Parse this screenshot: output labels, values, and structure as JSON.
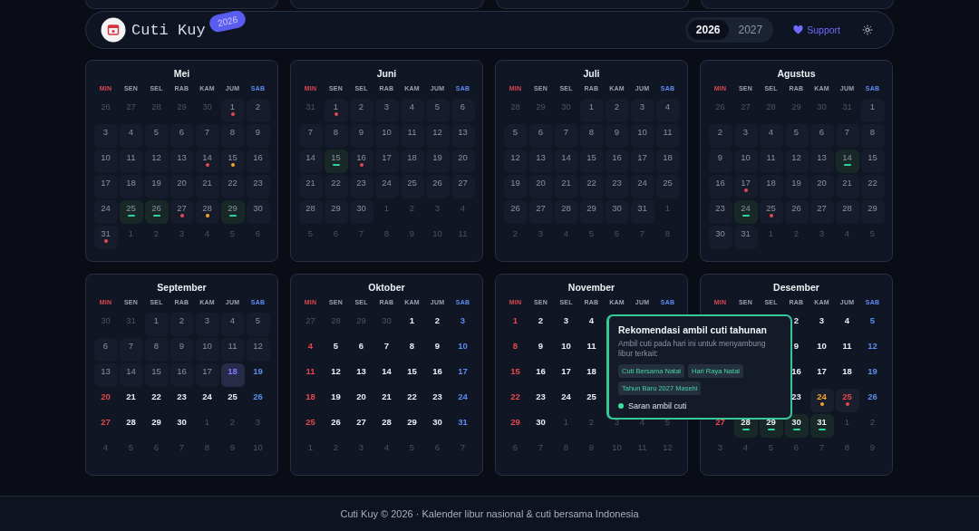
{
  "header": {
    "title": "Cuti Kuy",
    "badge": "2026",
    "years": [
      {
        "label": "2026",
        "selected": true
      },
      {
        "label": "2027",
        "selected": false
      }
    ],
    "support": "Support"
  },
  "months": [
    {
      "name": "Mei",
      "weekdays": [
        "MIN",
        "SEN",
        "SEL",
        "RAB",
        "KAM",
        "JUM",
        "SAB"
      ],
      "weeks": [
        {
          "days": [
            {
              "day": "26",
              "kind": "out"
            },
            {
              "day": "27",
              "kind": "out"
            },
            {
              "day": "28",
              "kind": "out"
            },
            {
              "day": "29",
              "kind": "out"
            },
            {
              "day": "30",
              "kind": "out"
            },
            {
              "day": "1",
              "kind": "past",
              "color": "#e5484d",
              "suggested": false
            },
            {
              "day": "2",
              "kind": "past"
            }
          ]
        },
        {
          "days": [
            {
              "day": "3",
              "kind": "past"
            },
            {
              "day": "4",
              "kind": "past"
            },
            {
              "day": "5",
              "kind": "past"
            },
            {
              "day": "6",
              "kind": "past"
            },
            {
              "day": "7",
              "kind": "past"
            },
            {
              "day": "8",
              "kind": "past"
            },
            {
              "day": "9",
              "kind": "past"
            }
          ]
        },
        {
          "days": [
            {
              "day": "10",
              "kind": "past"
            },
            {
              "day": "11",
              "kind": "past"
            },
            {
              "day": "12",
              "kind": "past"
            },
            {
              "day": "13",
              "kind": "past"
            },
            {
              "day": "14",
              "kind": "past",
              "color": "#e5484d",
              "suggested": false
            },
            {
              "day": "15",
              "kind": "past",
              "color": "#f5a524",
              "suggested": false
            },
            {
              "day": "16",
              "kind": "past"
            }
          ]
        },
        {
          "days": [
            {
              "day": "17",
              "kind": "past"
            },
            {
              "day": "18",
              "kind": "past"
            },
            {
              "day": "19",
              "kind": "past"
            },
            {
              "day": "20",
              "kind": "past"
            },
            {
              "day": "21",
              "kind": "past"
            },
            {
              "day": "22",
              "kind": "past"
            },
            {
              "day": "23",
              "kind": "past"
            }
          ]
        },
        {
          "days": [
            {
              "day": "24",
              "kind": "past"
            },
            {
              "day": "25",
              "kind": "past",
              "color": "#2fd3a0",
              "suggested": true
            },
            {
              "day": "26",
              "kind": "past",
              "color": "#2fd3a0",
              "suggested": true
            },
            {
              "day": "27",
              "kind": "past",
              "color": "#e5484d",
              "suggested": false
            },
            {
              "day": "28",
              "kind": "past",
              "color": "#f5a524",
              "suggested": false
            },
            {
              "day": "29",
              "kind": "past",
              "color": "#2fd3a0",
              "suggested": true
            },
            {
              "day": "30",
              "kind": "past"
            }
          ]
        },
        {
          "days": [
            {
              "day": "31",
              "kind": "past",
              "color": "#e5484d",
              "suggested": false
            },
            {
              "day": "1",
              "kind": "out"
            },
            {
              "day": "2",
              "kind": "out"
            },
            {
              "day": "3",
              "kind": "out"
            },
            {
              "day": "4",
              "kind": "out"
            },
            {
              "day": "5",
              "kind": "out"
            },
            {
              "day": "6",
              "kind": "out"
            }
          ]
        }
      ]
    },
    {
      "name": "Juni",
      "weekdays": [
        "MIN",
        "SEN",
        "SEL",
        "RAB",
        "KAM",
        "JUM",
        "SAB"
      ],
      "weeks": [
        {
          "days": [
            {
              "day": "31",
              "kind": "out"
            },
            {
              "day": "1",
              "kind": "past",
              "color": "#e5484d",
              "suggested": false
            },
            {
              "day": "2",
              "kind": "past"
            },
            {
              "day": "3",
              "kind": "past"
            },
            {
              "day": "4",
              "kind": "past"
            },
            {
              "day": "5",
              "kind": "past"
            },
            {
              "day": "6",
              "kind": "past"
            }
          ]
        },
        {
          "days": [
            {
              "day": "7",
              "kind": "past"
            },
            {
              "day": "8",
              "kind": "past"
            },
            {
              "day": "9",
              "kind": "past"
            },
            {
              "day": "10",
              "kind": "past"
            },
            {
              "day": "11",
              "kind": "past"
            },
            {
              "day": "12",
              "kind": "past"
            },
            {
              "day": "13",
              "kind": "past"
            }
          ]
        },
        {
          "days": [
            {
              "day": "14",
              "kind": "past"
            },
            {
              "day": "15",
              "kind": "past",
              "color": "#2fd3a0",
              "suggested": true
            },
            {
              "day": "16",
              "kind": "past",
              "color": "#e5484d",
              "suggested": false
            },
            {
              "day": "17",
              "kind": "past"
            },
            {
              "day": "18",
              "kind": "past"
            },
            {
              "day": "19",
              "kind": "past"
            },
            {
              "day": "20",
              "kind": "past"
            }
          ]
        },
        {
          "days": [
            {
              "day": "21",
              "kind": "past"
            },
            {
              "day": "22",
              "kind": "past"
            },
            {
              "day": "23",
              "kind": "past"
            },
            {
              "day": "24",
              "kind": "past"
            },
            {
              "day": "25",
              "kind": "past"
            },
            {
              "day": "26",
              "kind": "past"
            },
            {
              "day": "27",
              "kind": "past"
            }
          ]
        },
        {
          "days": [
            {
              "day": "28",
              "kind": "past"
            },
            {
              "day": "29",
              "kind": "past"
            },
            {
              "day": "30",
              "kind": "past"
            },
            {
              "day": "1",
              "kind": "out"
            },
            {
              "day": "2",
              "kind": "out"
            },
            {
              "day": "3",
              "kind": "out"
            },
            {
              "day": "4",
              "kind": "out"
            }
          ]
        },
        {
          "days": [
            {
              "day": "5",
              "kind": "out"
            },
            {
              "day": "6",
              "kind": "out"
            },
            {
              "day": "7",
              "kind": "out"
            },
            {
              "day": "8",
              "kind": "out"
            },
            {
              "day": "9",
              "kind": "out"
            },
            {
              "day": "10",
              "kind": "out"
            },
            {
              "day": "11",
              "kind": "out"
            }
          ]
        }
      ]
    },
    {
      "name": "Juli",
      "weekdays": [
        "MIN",
        "SEN",
        "SEL",
        "RAB",
        "KAM",
        "JUM",
        "SAB"
      ],
      "weeks": [
        {
          "days": [
            {
              "day": "28",
              "kind": "out"
            },
            {
              "day": "29",
              "kind": "out"
            },
            {
              "day": "30",
              "kind": "out"
            },
            {
              "day": "1",
              "kind": "past"
            },
            {
              "day": "2",
              "kind": "past"
            },
            {
              "day": "3",
              "kind": "past"
            },
            {
              "day": "4",
              "kind": "past"
            }
          ]
        },
        {
          "days": [
            {
              "day": "5",
              "kind": "past"
            },
            {
              "day": "6",
              "kind": "past"
            },
            {
              "day": "7",
              "kind": "past"
            },
            {
              "day": "8",
              "kind": "past"
            },
            {
              "day": "9",
              "kind": "past"
            },
            {
              "day": "10",
              "kind": "past"
            },
            {
              "day": "11",
              "kind": "past"
            }
          ]
        },
        {
          "days": [
            {
              "day": "12",
              "kind": "past"
            },
            {
              "day": "13",
              "kind": "past"
            },
            {
              "day": "14",
              "kind": "past"
            },
            {
              "day": "15",
              "kind": "past"
            },
            {
              "day": "16",
              "kind": "past"
            },
            {
              "day": "17",
              "kind": "past"
            },
            {
              "day": "18",
              "kind": "past"
            }
          ]
        },
        {
          "days": [
            {
              "day": "19",
              "kind": "past"
            },
            {
              "day": "20",
              "kind": "past"
            },
            {
              "day": "21",
              "kind": "past"
            },
            {
              "day": "22",
              "kind": "past"
            },
            {
              "day": "23",
              "kind": "past"
            },
            {
              "day": "24",
              "kind": "past"
            },
            {
              "day": "25",
              "kind": "past"
            }
          ]
        },
        {
          "days": [
            {
              "day": "26",
              "kind": "past"
            },
            {
              "day": "27",
              "kind": "past"
            },
            {
              "day": "28",
              "kind": "past"
            },
            {
              "day": "29",
              "kind": "past"
            },
            {
              "day": "30",
              "kind": "past"
            },
            {
              "day": "31",
              "kind": "past"
            },
            {
              "day": "1",
              "kind": "out"
            }
          ]
        },
        {
          "days": [
            {
              "day": "2",
              "kind": "out"
            },
            {
              "day": "3",
              "kind": "out"
            },
            {
              "day": "4",
              "kind": "out"
            },
            {
              "day": "5",
              "kind": "out"
            },
            {
              "day": "6",
              "kind": "out"
            },
            {
              "day": "7",
              "kind": "out"
            },
            {
              "day": "8",
              "kind": "out"
            }
          ]
        }
      ]
    },
    {
      "name": "Agustus",
      "weekdays": [
        "MIN",
        "SEN",
        "SEL",
        "RAB",
        "KAM",
        "JUM",
        "SAB"
      ],
      "weeks": [
        {
          "days": [
            {
              "day": "26",
              "kind": "out"
            },
            {
              "day": "27",
              "kind": "out"
            },
            {
              "day": "28",
              "kind": "out"
            },
            {
              "day": "29",
              "kind": "out"
            },
            {
              "day": "30",
              "kind": "out"
            },
            {
              "day": "31",
              "kind": "out"
            },
            {
              "day": "1",
              "kind": "past"
            }
          ]
        },
        {
          "days": [
            {
              "day": "2",
              "kind": "past"
            },
            {
              "day": "3",
              "kind": "past"
            },
            {
              "day": "4",
              "kind": "past"
            },
            {
              "day": "5",
              "kind": "past"
            },
            {
              "day": "6",
              "kind": "past"
            },
            {
              "day": "7",
              "kind": "past"
            },
            {
              "day": "8",
              "kind": "past"
            }
          ]
        },
        {
          "days": [
            {
              "day": "9",
              "kind": "past"
            },
            {
              "day": "10",
              "kind": "past"
            },
            {
              "day": "11",
              "kind": "past"
            },
            {
              "day": "12",
              "kind": "past"
            },
            {
              "day": "13",
              "kind": "past"
            },
            {
              "day": "14",
              "kind": "past",
              "color": "#2fd3a0",
              "suggested": true
            },
            {
              "day": "15",
              "kind": "past"
            }
          ]
        },
        {
          "days": [
            {
              "day": "16",
              "kind": "past"
            },
            {
              "day": "17",
              "kind": "past",
              "color": "#e5484d",
              "suggested": false
            },
            {
              "day": "18",
              "kind": "past"
            },
            {
              "day": "19",
              "kind": "past"
            },
            {
              "day": "20",
              "kind": "past"
            },
            {
              "day": "21",
              "kind": "past"
            },
            {
              "day": "22",
              "kind": "past"
            }
          ]
        },
        {
          "days": [
            {
              "day": "23",
              "kind": "past"
            },
            {
              "day": "24",
              "kind": "past",
              "color": "#2fd3a0",
              "suggested": true
            },
            {
              "day": "25",
              "kind": "past",
              "color": "#e5484d",
              "suggested": false
            },
            {
              "day": "26",
              "kind": "past"
            },
            {
              "day": "27",
              "kind": "past"
            },
            {
              "day": "28",
              "kind": "past"
            },
            {
              "day": "29",
              "kind": "past"
            }
          ]
        },
        {
          "days": [
            {
              "day": "30",
              "kind": "past"
            },
            {
              "day": "31",
              "kind": "past"
            },
            {
              "day": "1",
              "kind": "out"
            },
            {
              "day": "2",
              "kind": "out"
            },
            {
              "day": "3",
              "kind": "out"
            },
            {
              "day": "4",
              "kind": "out"
            },
            {
              "day": "5",
              "kind": "out"
            }
          ]
        }
      ]
    },
    {
      "name": "September",
      "weekdays": [
        "MIN",
        "SEN",
        "SEL",
        "RAB",
        "KAM",
        "JUM",
        "SAB"
      ],
      "weeks": [
        {
          "days": [
            {
              "day": "30",
              "kind": "out"
            },
            {
              "day": "31",
              "kind": "out"
            },
            {
              "day": "1",
              "kind": "past"
            },
            {
              "day": "2",
              "kind": "past"
            },
            {
              "day": "3",
              "kind": "past"
            },
            {
              "day": "4",
              "kind": "past"
            },
            {
              "day": "5",
              "kind": "past"
            }
          ]
        },
        {
          "days": [
            {
              "day": "6",
              "kind": "past"
            },
            {
              "day": "7",
              "kind": "past"
            },
            {
              "day": "8",
              "kind": "past"
            },
            {
              "day": "9",
              "kind": "past"
            },
            {
              "day": "10",
              "kind": "past"
            },
            {
              "day": "11",
              "kind": "past"
            },
            {
              "day": "12",
              "kind": "past"
            }
          ]
        },
        {
          "days": [
            {
              "day": "13",
              "kind": "past"
            },
            {
              "day": "14",
              "kind": "past"
            },
            {
              "day": "15",
              "kind": "past"
            },
            {
              "day": "16",
              "kind": "past"
            },
            {
              "day": "17",
              "kind": "past"
            },
            {
              "day": "18",
              "kind": "today"
            },
            {
              "day": "19",
              "kind": "future"
            }
          ]
        },
        {
          "days": [
            {
              "day": "20",
              "kind": "future"
            },
            {
              "day": "21",
              "kind": "future"
            },
            {
              "day": "22",
              "kind": "future"
            },
            {
              "day": "23",
              "kind": "future"
            },
            {
              "day": "24",
              "kind": "future"
            },
            {
              "day": "25",
              "kind": "future"
            },
            {
              "day": "26",
              "kind": "future"
            }
          ]
        },
        {
          "days": [
            {
              "day": "27",
              "kind": "future"
            },
            {
              "day": "28",
              "kind": "future"
            },
            {
              "day": "29",
              "kind": "future"
            },
            {
              "day": "30",
              "kind": "future"
            },
            {
              "day": "1",
              "kind": "out"
            },
            {
              "day": "2",
              "kind": "out"
            },
            {
              "day": "3",
              "kind": "out"
            }
          ]
        },
        {
          "days": [
            {
              "day": "4",
              "kind": "out"
            },
            {
              "day": "5",
              "kind": "out"
            },
            {
              "day": "6",
              "kind": "out"
            },
            {
              "day": "7",
              "kind": "out"
            },
            {
              "day": "8",
              "kind": "out"
            },
            {
              "day": "9",
              "kind": "out"
            },
            {
              "day": "10",
              "kind": "out"
            }
          ]
        }
      ]
    },
    {
      "name": "Oktober",
      "weekdays": [
        "MIN",
        "SEN",
        "SEL",
        "RAB",
        "KAM",
        "JUM",
        "SAB"
      ],
      "weeks": [
        {
          "days": [
            {
              "day": "27",
              "kind": "out"
            },
            {
              "day": "28",
              "kind": "out"
            },
            {
              "day": "29",
              "kind": "out"
            },
            {
              "day": "30",
              "kind": "out"
            },
            {
              "day": "1",
              "kind": "future"
            },
            {
              "day": "2",
              "kind": "future"
            },
            {
              "day": "3",
              "kind": "future"
            }
          ]
        },
        {
          "days": [
            {
              "day": "4",
              "kind": "future"
            },
            {
              "day": "5",
              "kind": "future"
            },
            {
              "day": "6",
              "kind": "future"
            },
            {
              "day": "7",
              "kind": "future"
            },
            {
              "day": "8",
              "kind": "future"
            },
            {
              "day": "9",
              "kind": "future"
            },
            {
              "day": "10",
              "kind": "future"
            }
          ]
        },
        {
          "days": [
            {
              "day": "11",
              "kind": "future"
            },
            {
              "day": "12",
              "kind": "future"
            },
            {
              "day": "13",
              "kind": "future"
            },
            {
              "day": "14",
              "kind": "future"
            },
            {
              "day": "15",
              "kind": "future"
            },
            {
              "day": "16",
              "kind": "future"
            },
            {
              "day": "17",
              "kind": "future"
            }
          ]
        },
        {
          "days": [
            {
              "day": "18",
              "kind": "future"
            },
            {
              "day": "19",
              "kind": "future"
            },
            {
              "day": "20",
              "kind": "future"
            },
            {
              "day": "21",
              "kind": "future"
            },
            {
              "day": "22",
              "kind": "future"
            },
            {
              "day": "23",
              "kind": "future"
            },
            {
              "day": "24",
              "kind": "future"
            }
          ]
        },
        {
          "days": [
            {
              "day": "25",
              "kind": "future"
            },
            {
              "day": "26",
              "kind": "future"
            },
            {
              "day": "27",
              "kind": "future"
            },
            {
              "day": "28",
              "kind": "future"
            },
            {
              "day": "29",
              "kind": "future"
            },
            {
              "day": "30",
              "kind": "future"
            },
            {
              "day": "31",
              "kind": "future"
            }
          ]
        },
        {
          "days": [
            {
              "day": "1",
              "kind": "out"
            },
            {
              "day": "2",
              "kind": "out"
            },
            {
              "day": "3",
              "kind": "out"
            },
            {
              "day": "4",
              "kind": "out"
            },
            {
              "day": "5",
              "kind": "out"
            },
            {
              "day": "6",
              "kind": "out"
            },
            {
              "day": "7",
              "kind": "out"
            }
          ]
        }
      ]
    },
    {
      "name": "November",
      "weekdays": [
        "MIN",
        "SEN",
        "SEL",
        "RAB",
        "KAM",
        "JUM",
        "SAB"
      ],
      "weeks": [
        {
          "days": [
            {
              "day": "1",
              "kind": "future"
            },
            {
              "day": "2",
              "kind": "future"
            },
            {
              "day": "3",
              "kind": "future"
            },
            {
              "day": "4",
              "kind": "future"
            },
            {
              "kind": "covered"
            },
            {
              "kind": "covered"
            },
            {
              "kind": "covered"
            }
          ]
        },
        {
          "days": [
            {
              "day": "8",
              "kind": "future"
            },
            {
              "day": "9",
              "kind": "future"
            },
            {
              "day": "10",
              "kind": "future"
            },
            {
              "day": "11",
              "kind": "future"
            },
            {
              "kind": "covered"
            },
            {
              "kind": "covered"
            },
            {
              "kind": "covered"
            }
          ]
        },
        {
          "days": [
            {
              "day": "15",
              "kind": "future"
            },
            {
              "day": "16",
              "kind": "future"
            },
            {
              "day": "17",
              "kind": "future"
            },
            {
              "day": "18",
              "kind": "future"
            },
            {
              "kind": "covered"
            },
            {
              "kind": "covered"
            },
            {
              "kind": "covered"
            }
          ]
        },
        {
          "days": [
            {
              "day": "22",
              "kind": "future"
            },
            {
              "day": "23",
              "kind": "future"
            },
            {
              "day": "24",
              "kind": "future"
            },
            {
              "day": "25",
              "kind": "future"
            },
            {
              "kind": "covered"
            },
            {
              "kind": "covered"
            },
            {
              "kind": "covered"
            }
          ]
        },
        {
          "days": [
            {
              "day": "29",
              "kind": "future"
            },
            {
              "day": "30",
              "kind": "future"
            },
            {
              "day": "1",
              "kind": "out"
            },
            {
              "day": "2",
              "kind": "out"
            },
            {
              "day": "3",
              "kind": "out"
            },
            {
              "day": "4",
              "kind": "out"
            },
            {
              "day": "5",
              "kind": "out"
            }
          ]
        },
        {
          "days": [
            {
              "day": "6",
              "kind": "out"
            },
            {
              "day": "7",
              "kind": "out"
            },
            {
              "day": "8",
              "kind": "out"
            },
            {
              "day": "9",
              "kind": "out"
            },
            {
              "day": "10",
              "kind": "out"
            },
            {
              "day": "11",
              "kind": "out"
            },
            {
              "day": "12",
              "kind": "out"
            }
          ]
        }
      ]
    },
    {
      "name": "Desember",
      "weekdays": [
        "MIN",
        "SEN",
        "SEL",
        "RAB",
        "KAM",
        "JUM",
        "SAB"
      ],
      "weeks": [
        {
          "days": [
            {
              "kind": "covered"
            },
            {
              "kind": "covered"
            },
            {
              "kind": "covered"
            },
            {
              "day": "2",
              "kind": "future"
            },
            {
              "day": "3",
              "kind": "future"
            },
            {
              "day": "4",
              "kind": "future"
            },
            {
              "day": "5",
              "kind": "future"
            }
          ]
        },
        {
          "days": [
            {
              "kind": "covered"
            },
            {
              "kind": "covered"
            },
            {
              "kind": "covered"
            },
            {
              "day": "9",
              "kind": "future"
            },
            {
              "day": "10",
              "kind": "future"
            },
            {
              "day": "11",
              "kind": "future"
            },
            {
              "day": "12",
              "kind": "future"
            }
          ]
        },
        {
          "days": [
            {
              "kind": "covered"
            },
            {
              "kind": "covered"
            },
            {
              "kind": "covered"
            },
            {
              "day": "16",
              "kind": "future"
            },
            {
              "day": "17",
              "kind": "future"
            },
            {
              "day": "18",
              "kind": "future"
            },
            {
              "day": "19",
              "kind": "future"
            }
          ]
        },
        {
          "days": [
            {
              "kind": "covered"
            },
            {
              "kind": "covered"
            },
            {
              "kind": "covered"
            },
            {
              "day": "23",
              "kind": "future"
            },
            {
              "day": "24",
              "kind": "future",
              "color": "#f5a524",
              "suggested": false
            },
            {
              "day": "25",
              "kind": "future",
              "color": "#e5484d",
              "suggested": false
            },
            {
              "day": "26",
              "kind": "future"
            }
          ]
        },
        {
          "days": [
            {
              "day": "27",
              "kind": "future"
            },
            {
              "day": "28",
              "kind": "future",
              "color": "#2fd3a0",
              "suggested": true
            },
            {
              "day": "29",
              "kind": "future",
              "color": "#2fd3a0",
              "suggested": true
            },
            {
              "day": "30",
              "kind": "future",
              "color": "#2fd3a0",
              "suggested": true
            },
            {
              "day": "31",
              "kind": "future",
              "color": "#2fd3a0",
              "suggested": true
            },
            {
              "day": "1",
              "kind": "out"
            },
            {
              "day": "2",
              "kind": "out"
            }
          ]
        },
        {
          "days": [
            {
              "day": "3",
              "kind": "out"
            },
            {
              "day": "4",
              "kind": "out"
            },
            {
              "day": "5",
              "kind": "out"
            },
            {
              "day": "6",
              "kind": "out"
            },
            {
              "day": "7",
              "kind": "out"
            },
            {
              "day": "8",
              "kind": "out"
            },
            {
              "day": "9",
              "kind": "out"
            }
          ]
        }
      ]
    }
  ],
  "tooltip": {
    "title": "Rekomendasi ambil cuti tahunan",
    "text": "Ambil cuti pada hari ini untuk menyambung libur terkait:",
    "chips": [
      "Cuti Bersama Natal",
      "Hari Raya Natal",
      "Tahun Baru 2027 Masehi"
    ],
    "legend": "Saran ambil cuti"
  },
  "footer": "Cuti Kuy © 2026 · Kalender libur nasional & cuti bersama Indonesia"
}
